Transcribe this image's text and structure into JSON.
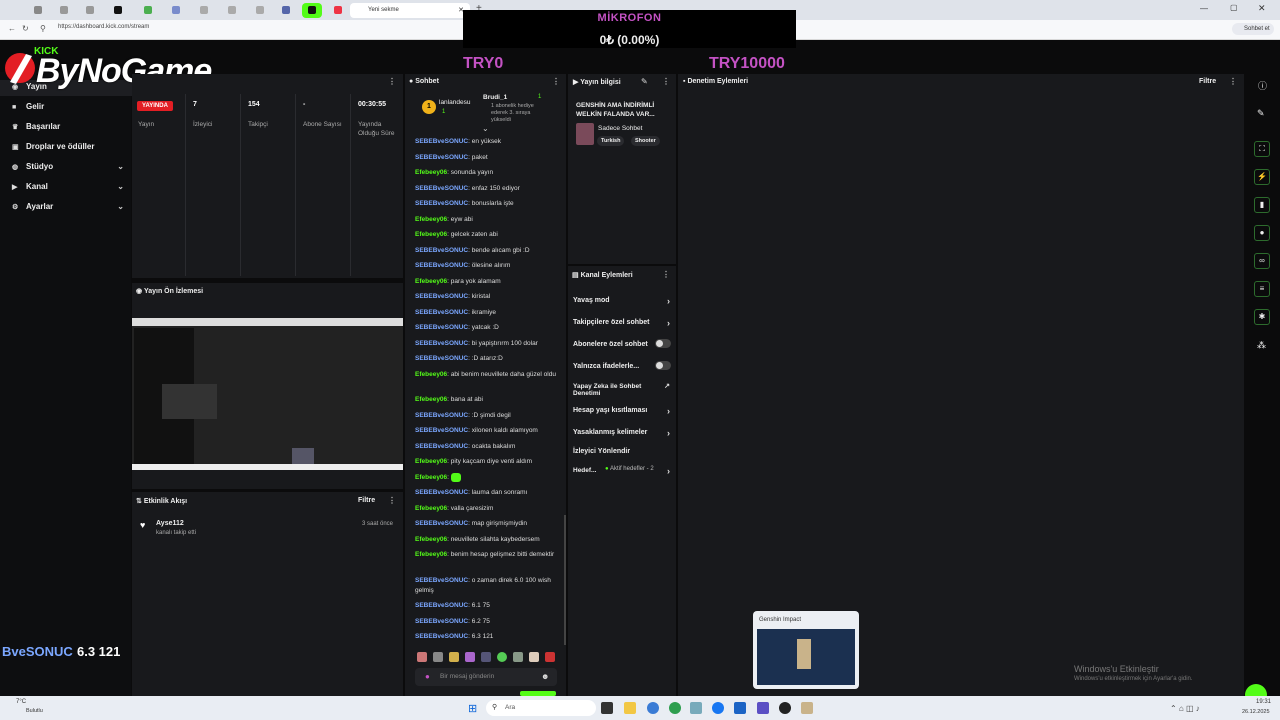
{
  "browser": {
    "active_tab_title": "Yeni sekme",
    "url": "https://dashboard.kick.com/stream",
    "right_button": "Sohbet et"
  },
  "overlay": {
    "mic_label": "MİKROFON",
    "mic_value": "0₺ (0.00%)",
    "goal_start": "TRY0",
    "goal_end": "TRY10000"
  },
  "logo": {
    "kick": "KICK",
    "brand": "ByNoGame"
  },
  "sidebar": {
    "items": [
      {
        "label": "Yayın",
        "icon": "broadcast-icon"
      },
      {
        "label": "Gelir",
        "icon": "money-icon"
      },
      {
        "label": "Başarılar",
        "icon": "trophy-icon"
      },
      {
        "label": "Droplar ve ödüller",
        "icon": "gift-icon"
      },
      {
        "label": "Stüdyo",
        "icon": "studio-icon"
      },
      {
        "label": "Kanal",
        "icon": "channel-icon"
      },
      {
        "label": "Ayarlar",
        "icon": "gear-icon"
      }
    ],
    "overlay_name": "BveSONUC",
    "overlay_value": "6.3 121"
  },
  "stats": {
    "live_badge": "YAYINDA",
    "items": [
      {
        "value": "",
        "label": "Yayın"
      },
      {
        "value": "7",
        "label": "İzleyici"
      },
      {
        "value": "154",
        "label": "Takipçi"
      },
      {
        "value": "-",
        "label": "Abone Sayısı"
      },
      {
        "value": "00:30:55",
        "label": "Yayında Olduğu Süre"
      }
    ]
  },
  "preview": {
    "title": "Yayın Ön İzlemesi"
  },
  "activity": {
    "title": "Etkinlik Akışı",
    "filter": "Filtre",
    "event_user": "Ayse112",
    "event_text": "kanalı takip etti",
    "event_time": "3 saat önce"
  },
  "chat": {
    "title": "Sohbet",
    "pinned_user1": "lanlandesu",
    "pinned_count1": "1",
    "pinned_user2": "Brudi_1",
    "pinned_count2": "1",
    "pinned_text": "1 abonelik hediye ederek 3. sıraya yükseldi",
    "placeholder": "Bir mesaj gönderin",
    "messages": [
      {
        "user": "SEBEBveSONUC",
        "text": "en yüksek",
        "c": "u1"
      },
      {
        "user": "SEBEBveSONUC",
        "text": "paket",
        "c": "u1"
      },
      {
        "user": "Efebeey06",
        "text": "sonunda yayın",
        "c": "u2"
      },
      {
        "user": "SEBEBveSONUC",
        "text": "enfaz 150 ediyor",
        "c": "u1"
      },
      {
        "user": "SEBEBveSONUC",
        "text": "bonuslarla işte",
        "c": "u1"
      },
      {
        "user": "Efebeey06",
        "text": "eyw abi",
        "c": "u2"
      },
      {
        "user": "Efebeey06",
        "text": "gelcek zaten abi",
        "c": "u2"
      },
      {
        "user": "SEBEBveSONUC",
        "text": "bende alıcam gbi :D",
        "c": "u1"
      },
      {
        "user": "SEBEBveSONUC",
        "text": "ölesine alırım",
        "c": "u1"
      },
      {
        "user": "Efebeey06",
        "text": "para yok alamam",
        "c": "u2"
      },
      {
        "user": "SEBEBveSONUC",
        "text": "kiristal",
        "c": "u1"
      },
      {
        "user": "SEBEBveSONUC",
        "text": "ikramiye",
        "c": "u1"
      },
      {
        "user": "SEBEBveSONUC",
        "text": "yatcak :D",
        "c": "u1"
      },
      {
        "user": "SEBEBveSONUC",
        "text": "bi yapiştırırm 100 dolar",
        "c": "u1"
      },
      {
        "user": "SEBEBveSONUC",
        "text": ":D atarız:D",
        "c": "u1"
      },
      {
        "user": "Efebeey06",
        "text": "abi benim neuvillete daha güzel oldu",
        "c": "u2"
      },
      {
        "user": "Efebeey06",
        "text": "bana at abi",
        "c": "u2"
      },
      {
        "user": "SEBEBveSONUC",
        "text": ":D şimdi degil",
        "c": "u1"
      },
      {
        "user": "SEBEBveSONUC",
        "text": "xilonen kaldı alamıyom",
        "c": "u1"
      },
      {
        "user": "SEBEBveSONUC",
        "text": "ocakta bakalım",
        "c": "u1"
      },
      {
        "user": "Efebeey06",
        "text": "pity kaçcam diye venti aldım",
        "c": "u2"
      },
      {
        "user": "Efebeey06",
        "text": "",
        "c": "u2"
      },
      {
        "user": "SEBEBveSONUC",
        "text": "lauma dan sonramı",
        "c": "u1"
      },
      {
        "user": "Efebeey06",
        "text": "valla çaresizim",
        "c": "u2"
      },
      {
        "user": "SEBEBveSONUC",
        "text": "map girişmişmiydin",
        "c": "u1"
      },
      {
        "user": "Efebeey06",
        "text": "neuvillete silahta kaybedersem",
        "c": "u2"
      },
      {
        "user": "Efebeey06",
        "text": "benim hesap gelişmez bitti demektir",
        "c": "u2"
      },
      {
        "user": "SEBEBveSONUC",
        "text": "o zaman direk 6.0 100 wish gelmiş",
        "c": "u1"
      },
      {
        "user": "SEBEBveSONUC",
        "text": "6.1 75",
        "c": "u1"
      },
      {
        "user": "SEBEBveSONUC",
        "text": "6.2 75",
        "c": "u1"
      },
      {
        "user": "SEBEBveSONUC",
        "text": "6.3 121",
        "c": "u1"
      }
    ]
  },
  "stream_info": {
    "title": "Yayın bilgisi",
    "stream_title": "GENSHİN AMA İNDİRİMLİ WELKİN FALANDA VAR...",
    "category": "Sadece Sohbet",
    "tags": [
      "Turkish",
      "Shooter"
    ]
  },
  "channel_actions": {
    "title": "Kanal Eylemleri",
    "items": [
      {
        "label": "Yavaş mod",
        "kind": "arrow"
      },
      {
        "label": "Takipçilere özel sohbet",
        "kind": "arrow"
      },
      {
        "label": "Abonelere özel sohbet",
        "kind": "toggle"
      },
      {
        "label": "Yalnızca ifadelerle...",
        "kind": "toggle"
      },
      {
        "label": "Yapay Zeka ile Sohbet Denetimi",
        "kind": "ext"
      },
      {
        "label": "Hesap yaşı kısıtlaması",
        "kind": "arrow"
      },
      {
        "label": "Yasaklanmış kelimeler",
        "kind": "arrow"
      },
      {
        "label": "İzleyici Yönlendir",
        "kind": "none"
      },
      {
        "label": "Hedef...",
        "kind": "arrow"
      }
    ],
    "goal_status": "Aktif hedefler - 2"
  },
  "moderation": {
    "title": "Denetim Eylemleri",
    "filter": "Filtre"
  },
  "popup": {
    "title": "Genshin Impact"
  },
  "watermark": {
    "line1": "Windows'u Etkinleştir",
    "line2": "Windows'u etkinleştirmek için Ayarlar'a gidin."
  },
  "taskbar": {
    "weather_temp": "7°C",
    "weather_text": "Bulutlu",
    "search": "Ara",
    "time": "19:31",
    "date": "26.12.2025"
  }
}
